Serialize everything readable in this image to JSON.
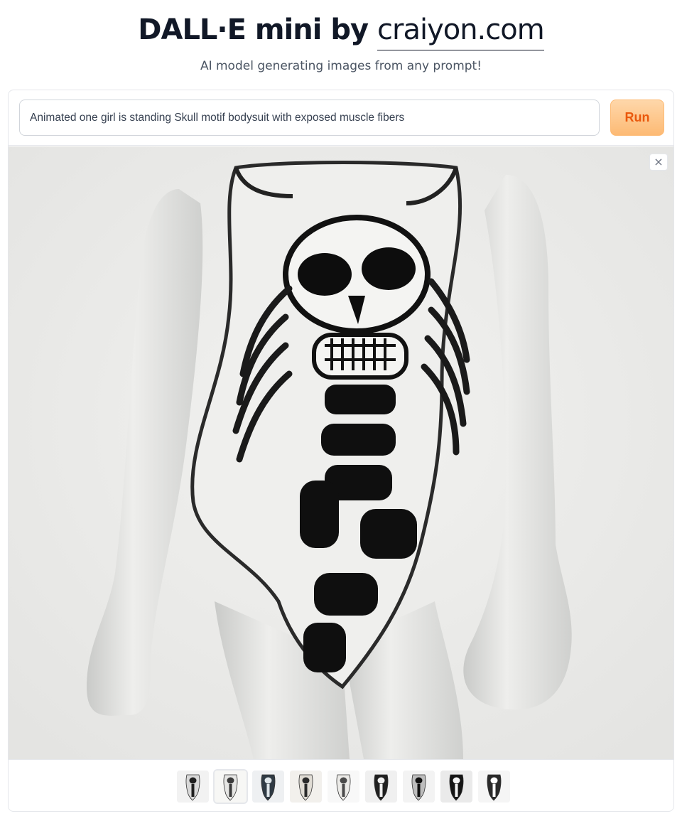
{
  "header": {
    "title_main": "DALL·E mini by ",
    "title_link": "craiyon.com",
    "subtitle": "AI model generating images from any prompt!"
  },
  "prompt": {
    "value": "Animated one girl is standing Skull motif bodysuit with exposed muscle fibers",
    "run_label": "Run"
  },
  "result": {
    "close_label": "×",
    "image_icon": "generated-image",
    "thumbnail_count": 9,
    "selected_index": 1
  },
  "colors": {
    "accent": "#ea580c",
    "button_bg": "#fdba74",
    "border": "#e5e7eb"
  }
}
